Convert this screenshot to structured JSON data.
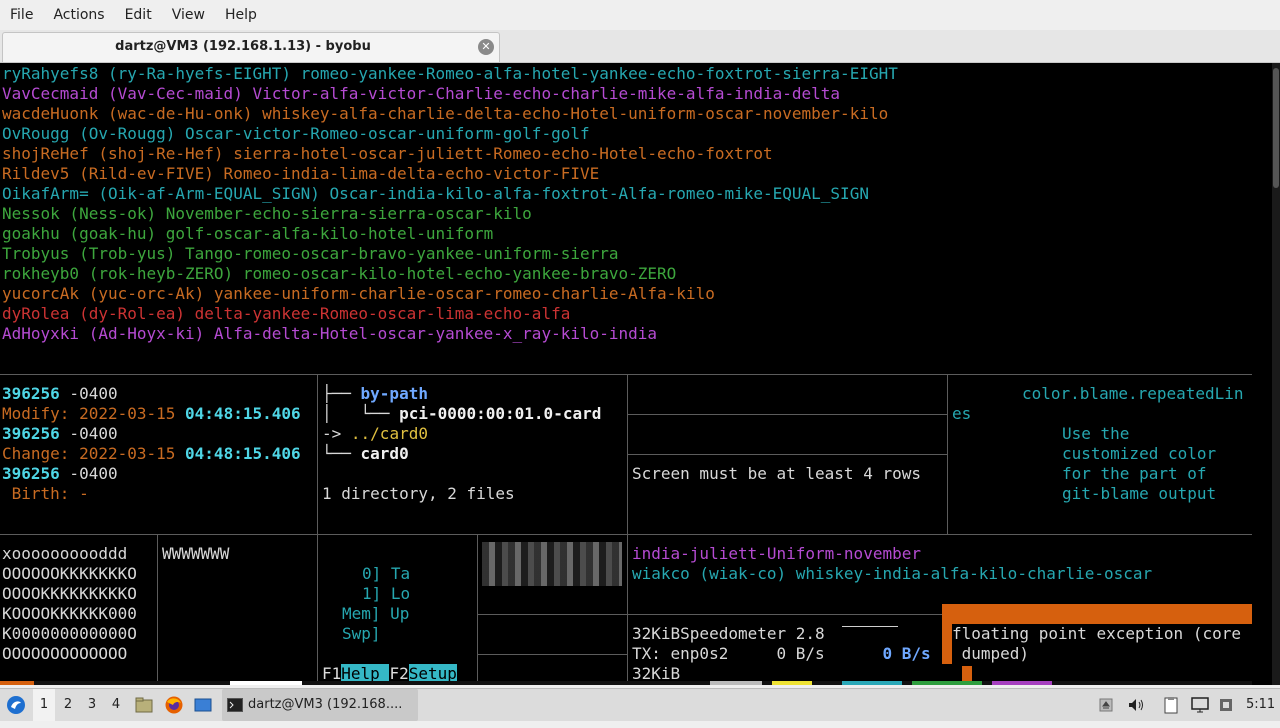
{
  "menu": [
    "File",
    "Actions",
    "Edit",
    "View",
    "Help"
  ],
  "tab": {
    "title": "dartz@VM3 (192.168.1.13) - byobu"
  },
  "top_lines": [
    {
      "c": "cy",
      "t": "ryRahyefs8 (ry-Ra-hyefs-EIGHT) romeo-yankee-Romeo-alfa-hotel-yankee-echo-foxtrot-sierra-EIGHT"
    },
    {
      "c": "mg",
      "t": "VavCecmaid (Vav-Cec-maid) Victor-alfa-victor-Charlie-echo-charlie-mike-alfa-india-delta"
    },
    {
      "c": "or",
      "t": "wacdeHuonk (wac-de-Hu-onk) whiskey-alfa-charlie-delta-echo-Hotel-uniform-oscar-november-kilo"
    },
    {
      "c": "cy",
      "t": "OvRougg (Ov-Rougg) Oscar-victor-Romeo-oscar-uniform-golf-golf"
    },
    {
      "c": "or",
      "t": "shojReHef (shoj-Re-Hef) sierra-hotel-oscar-juliett-Romeo-echo-Hotel-echo-foxtrot"
    },
    {
      "c": "or",
      "t": "Rildev5 (Rild-ev-FIVE) Romeo-india-lima-delta-echo-victor-FIVE"
    },
    {
      "c": "cy",
      "t": "OikafArm= (Oik-af-Arm-EQUAL_SIGN) Oscar-india-kilo-alfa-foxtrot-Alfa-romeo-mike-EQUAL_SIGN"
    },
    {
      "c": "gr",
      "t": "Nessok (Ness-ok) November-echo-sierra-sierra-oscar-kilo"
    },
    {
      "c": "gr",
      "t": "goakhu (goak-hu) golf-oscar-alfa-kilo-hotel-uniform"
    },
    {
      "c": "gr",
      "t": "Trobyus (Trob-yus) Tango-romeo-oscar-bravo-yankee-uniform-sierra"
    },
    {
      "c": "gr",
      "t": "rokheyb0 (rok-heyb-ZERO) romeo-oscar-kilo-hotel-echo-yankee-bravo-ZERO"
    },
    {
      "c": "or",
      "t": "yucorcAk (yuc-orc-Ak) yankee-uniform-charlie-oscar-romeo-charlie-Alfa-kilo"
    },
    {
      "c": "rd",
      "t": "dyRolea (dy-Rol-ea) delta-yankee-Romeo-oscar-lima-echo-alfa"
    },
    {
      "c": "mg",
      "t": "AdHoyxki (Ad-Hoyx-ki) Alfa-delta-Hotel-oscar-yankee-x_ray-kilo-india"
    }
  ],
  "stat": {
    "l1n": "396256",
    "l1z": " -0400",
    "mod_label": "Modify: ",
    "mod_date": "2022-03-15 ",
    "mod_time": "04:48:15.406",
    "l3n": "396256",
    "l3z": " -0400",
    "chg_label": "Change: ",
    "chg_date": "2022-03-15 ",
    "chg_time": "04:48:15.406",
    "l5n": "396256",
    "l5z": " -0400",
    "birth": " Birth: -"
  },
  "tree": {
    "branch1": "├── ",
    "by_path": "by-path",
    "branch2": "│   └── ",
    "pci": "pci-0000:00:01.0-card",
    "arrow": "-> ",
    "card0_link": "../card0",
    "branch3": "└── ",
    "card0": "card0",
    "summary": "1 directory, 2 files"
  },
  "screen_msg": "Screen must be at least 4 rows",
  "git_help": {
    "l1": "color.blame.repeatedLin",
    "l2": "es",
    "l3": "Use the",
    "l4": "customized color",
    "l5": "for the part of",
    "l6": "git-blame output"
  },
  "matrix": [
    "xoooooooooddd",
    "OOOOOOKKKKKKKO",
    "OOOOKKKKKKKKKO",
    "KOOOOKKKKKK000",
    "K000000000000O",
    "OOOOOOOOOOOOO"
  ],
  "wwwline": "WWWWWWW",
  "htop": {
    "l0": "0] Ta",
    "l1": "1] Lo",
    "mem": "Mem] Up",
    "swp": "Swp]",
    "f1": "F1",
    "help": "Help ",
    "f2": "F2",
    "setup": "Setup"
  },
  "nato": {
    "l1": "india-juliett-Uniform-november",
    "l2": "wiakco (wiak-co) whiskey-india-alfa-kilo-charlie-oscar"
  },
  "speed": {
    "l1": "32KiBSpeedometer 2.8",
    "l2a": "TX: enp0s2     0 B/s      ",
    "l2b": "0 B/s",
    "l3": "32KiB"
  },
  "fpe": {
    "l1": "floating point exception (core",
    "l2": " dumped)"
  },
  "taskbar": {
    "workspaces": [
      "1",
      "2",
      "3",
      "4"
    ],
    "active_ws": "1",
    "task": "dartz@VM3 (192.168....",
    "clock": "5:11"
  }
}
